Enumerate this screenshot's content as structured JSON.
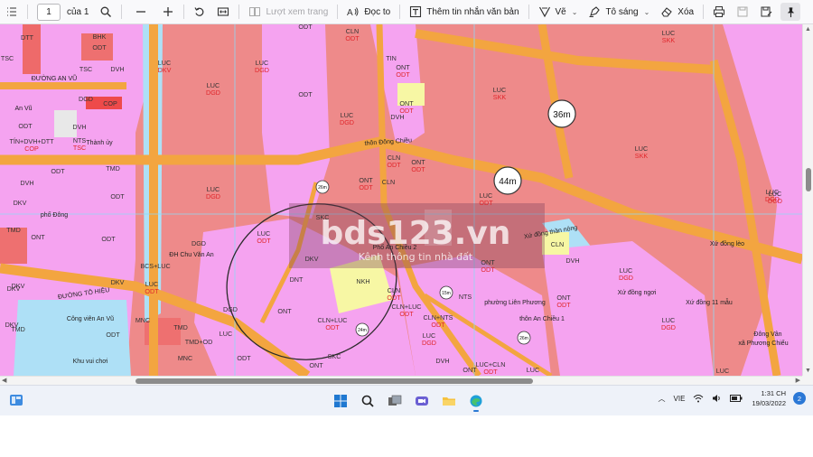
{
  "toolbar": {
    "page_number": "1",
    "page_total": "của 1",
    "find_icon": "search-icon",
    "zoom_out_icon": "minus-icon",
    "zoom_in_icon": "plus-icon",
    "page_view_label": "Lượt xem trang",
    "read_aloud_label": "Đọc to",
    "add_text_label": "Thêm tin nhắn văn bản",
    "draw_label": "Vẽ",
    "highlight_label": "Tô sáng",
    "erase_label": "Xóa"
  },
  "map": {
    "road_labels": [
      "36m",
      "44m",
      "26m",
      "15m",
      "24m",
      "26m"
    ],
    "streets": [
      "ĐƯỜNG AN VŨ",
      "ĐƯỜNG TÔ HIỆU",
      "thôn Đông Chiều",
      "phố Đông",
      "Phố An Chiều 2",
      "phường Liên Phương",
      "thôn An Chiều 1",
      "Xứ đồng thần nông",
      "Xứ đồng lèo",
      "Xứ đồng ngơi",
      "Xứ đồng 11 mẫu",
      "Đông Vân",
      "xã Phương Chiểu",
      "Công viên An Vũ",
      "Khu vui chơi",
      "ĐH Chu Văn An",
      "Thành ủy",
      "An Vũ"
    ],
    "parcels": [
      {
        "t": "DTT",
        "b": ""
      },
      {
        "t": "TSC",
        "b": ""
      },
      {
        "t": "BHK",
        "b": ""
      },
      {
        "t": "ODT",
        "b": ""
      },
      {
        "t": "DVH",
        "b": ""
      },
      {
        "t": "TSC",
        "b": ""
      },
      {
        "t": "DGD",
        "b": ""
      },
      {
        "t": "COP",
        "b": ""
      },
      {
        "t": "DVH",
        "b": ""
      },
      {
        "t": "NTS",
        "b": "TSC"
      },
      {
        "t": "ODT",
        "b": ""
      },
      {
        "t": "TÍN+DVH+DTT",
        "b": "COP"
      },
      {
        "t": "TMD",
        "b": ""
      },
      {
        "t": "DVH",
        "b": ""
      },
      {
        "t": "ODT",
        "b": ""
      },
      {
        "t": "DKV",
        "b": ""
      },
      {
        "t": "TMD",
        "b": ""
      },
      {
        "t": "ONT",
        "b": ""
      },
      {
        "t": "ODT",
        "b": ""
      },
      {
        "t": "DKV",
        "b": ""
      },
      {
        "t": "DKV",
        "b": ""
      },
      {
        "t": "LUC",
        "b": "DKV"
      },
      {
        "t": "LUC",
        "b": "DGD"
      },
      {
        "t": "LUC",
        "b": "DGD"
      },
      {
        "t": "LUC",
        "b": "DGD"
      },
      {
        "t": "ODT",
        "b": ""
      },
      {
        "t": "ODT",
        "b": ""
      },
      {
        "t": "CLN",
        "b": "ODT"
      },
      {
        "t": "LUC",
        "b": "DGD"
      },
      {
        "t": "TIN",
        "b": ""
      },
      {
        "t": "ONT",
        "b": "ODT"
      },
      {
        "t": "ONT",
        "b": "ODT"
      },
      {
        "t": "DVH",
        "b": ""
      },
      {
        "t": "LUC",
        "b": "SKK"
      },
      {
        "t": "LUC",
        "b": "SKK"
      },
      {
        "t": "LUC",
        "b": "SKK"
      },
      {
        "t": "LUC",
        "b": "DGD"
      },
      {
        "t": "CLN",
        "b": "ODT"
      },
      {
        "t": "ONT",
        "b": "ODT"
      },
      {
        "t": "ONT",
        "b": "ODT"
      },
      {
        "t": "CLN",
        "b": ""
      },
      {
        "t": "LUC",
        "b": "ODT"
      },
      {
        "t": "DGD",
        "b": ""
      },
      {
        "t": "SKC",
        "b": ""
      },
      {
        "t": "DKV",
        "b": ""
      },
      {
        "t": "BCS+LUC",
        "b": ""
      },
      {
        "t": "LUC",
        "b": "ODT"
      },
      {
        "t": "NKH",
        "b": ""
      },
      {
        "t": "DNT",
        "b": ""
      },
      {
        "t": "ONT",
        "b": ""
      },
      {
        "t": "CLN+LUC",
        "b": "ODT"
      },
      {
        "t": "CLN+LUC",
        "b": "ODT"
      },
      {
        "t": "CLN+NTS",
        "b": "ODT"
      },
      {
        "t": "CLN",
        "b": "ODT"
      },
      {
        "t": "NTS",
        "b": ""
      },
      {
        "t": "ONT",
        "b": "ODT"
      },
      {
        "t": "ONT",
        "b": "ODT"
      },
      {
        "t": "LUC",
        "b": "DGD"
      },
      {
        "t": "LUC",
        "b": "ODT"
      },
      {
        "t": "LUC",
        "b": "DGD"
      },
      {
        "t": "LUC",
        "b": "DGD"
      },
      {
        "t": "CLN",
        "b": ""
      },
      {
        "t": "DVH",
        "b": ""
      },
      {
        "t": "LUC",
        "b": "DGD"
      },
      {
        "t": "ODT",
        "b": ""
      },
      {
        "t": "DGD",
        "b": ""
      },
      {
        "t": "LUC",
        "b": ""
      },
      {
        "t": "SKC",
        "b": ""
      },
      {
        "t": "LUC+CLN",
        "b": "ODT"
      },
      {
        "t": "TMD",
        "b": ""
      },
      {
        "t": "MNC",
        "b": ""
      },
      {
        "t": "TMD+OD",
        "b": ""
      },
      {
        "t": "DKV",
        "b": ""
      },
      {
        "t": "TMD",
        "b": ""
      },
      {
        "t": "ODT",
        "b": ""
      },
      {
        "t": "DKV",
        "b": ""
      },
      {
        "t": "MNC",
        "b": ""
      },
      {
        "t": "LUC",
        "b": ""
      },
      {
        "t": "ODT",
        "b": ""
      },
      {
        "t": "ONT",
        "b": ""
      },
      {
        "t": "DVH",
        "b": ""
      },
      {
        "t": "LUC",
        "b": ""
      },
      {
        "t": "ONT",
        "b": ""
      }
    ],
    "watermark_main": "bds123.vn",
    "watermark_sub": "Kênh thông tin nhà đất"
  },
  "taskbar": {
    "language": "VIE",
    "time": "1:31 CH",
    "date": "19/03/2022",
    "notifications": "2"
  },
  "colors": {
    "road": "#f3a540",
    "odt": "#f5a3f0",
    "luc": "#ee8a8a",
    "water": "#aee0f6",
    "nkh": "#f7f7a4",
    "label_red": "#e0262b"
  }
}
